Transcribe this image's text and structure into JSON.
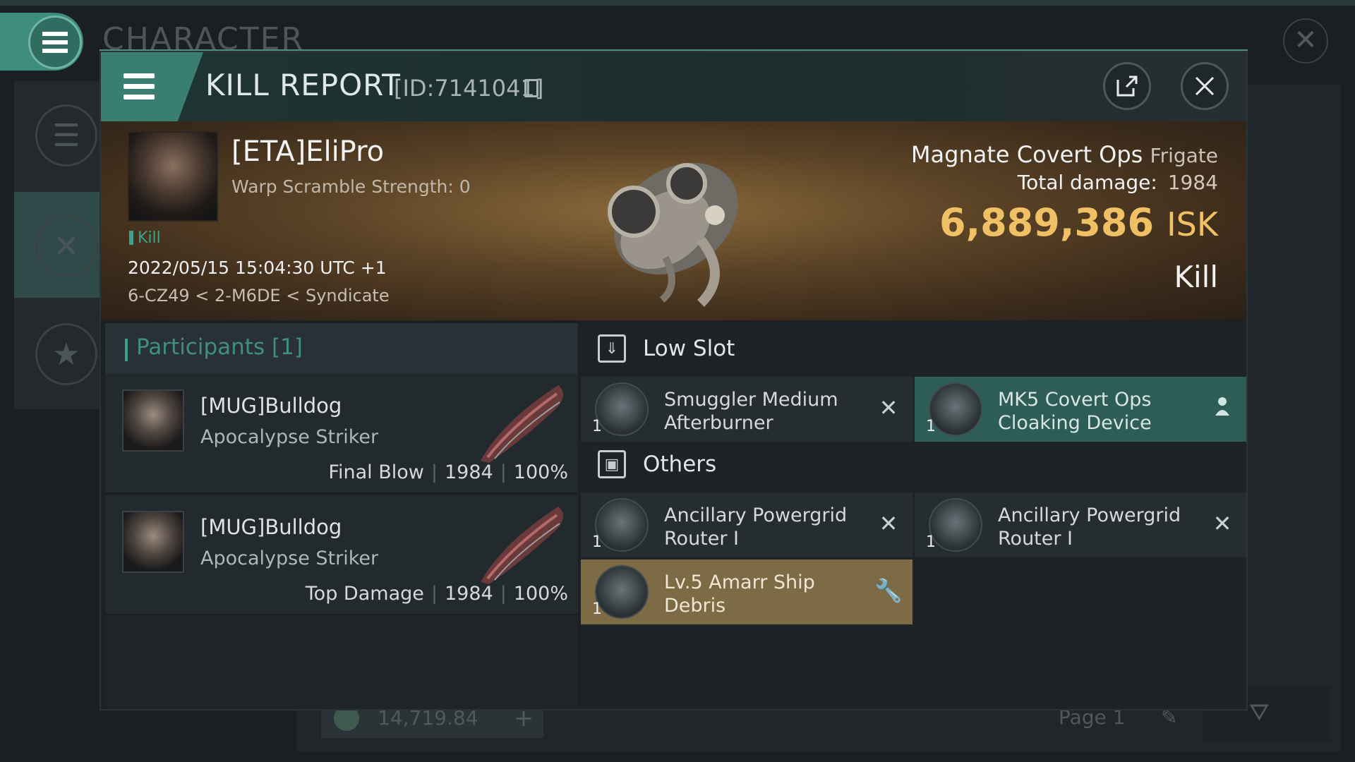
{
  "background": {
    "title": "CHARACTER",
    "bottom_value": "14,719.84",
    "page_label": "Page 1",
    "icons": [
      "menu-icon",
      "list-icon",
      "crossed-swords-icon",
      "star-icon",
      "close-icon",
      "filter-icon",
      "pencil-icon",
      "plus-icon"
    ]
  },
  "header": {
    "title": "KILL REPORT",
    "id_label": "[ID:7141041]",
    "share_icon": "share-icon",
    "close_icon": "close-icon"
  },
  "victim": {
    "name": "[ETA]EliPro",
    "warp_scramble": "Warp Scramble Strength: 0",
    "tag": "Kill",
    "date": "2022/05/15 15:04:30 UTC +1",
    "location": "6-CZ49 < 2-M6DE < Syndicate",
    "ship_name": "Magnate Covert Ops",
    "ship_class": "Frigate",
    "total_damage_label": "Total damage:",
    "total_damage_value": "1984",
    "isk_value": "6,889,386",
    "isk_unit": "ISK",
    "result": "Kill"
  },
  "participants": {
    "title": "Participants",
    "count": "[1]",
    "rows": [
      {
        "name": "[MUG]Bulldog",
        "ship": "Apocalypse Striker",
        "role": "Final Blow",
        "damage": "1984",
        "percent": "100%"
      },
      {
        "name": "[MUG]Bulldog",
        "ship": "Apocalypse Striker",
        "role": "Top Damage",
        "damage": "1984",
        "percent": "100%"
      }
    ]
  },
  "sections": {
    "low_slot": {
      "title": "Low Slot",
      "items": [
        {
          "qty": "1",
          "name_line1": "Smuggler Medium",
          "name_line2": "Afterburner",
          "status_icon": "destroyed-x-icon"
        },
        {
          "qty": "1",
          "name_line1": "MK5 Covert Ops",
          "name_line2": "Cloaking Device",
          "status_icon": "dropped-person-icon"
        }
      ]
    },
    "others": {
      "title": "Others",
      "items": [
        {
          "qty": "1",
          "name_line1": "Ancillary Powergrid",
          "name_line2": "Router I",
          "status_icon": "destroyed-x-icon"
        },
        {
          "qty": "1",
          "name_line1": "Ancillary Powergrid",
          "name_line2": "Router I",
          "status_icon": "destroyed-x-icon"
        },
        {
          "qty": "1",
          "name_line1": "Lv.5 Amarr Ship",
          "name_line2": "Debris",
          "status_icon": "wrench-icon"
        }
      ]
    }
  },
  "colors": {
    "accent_green": "#3a7d71",
    "isk_gold": "#f0c064",
    "dropped_item": "#2e5c57",
    "salvage_item": "#7c6b45"
  }
}
